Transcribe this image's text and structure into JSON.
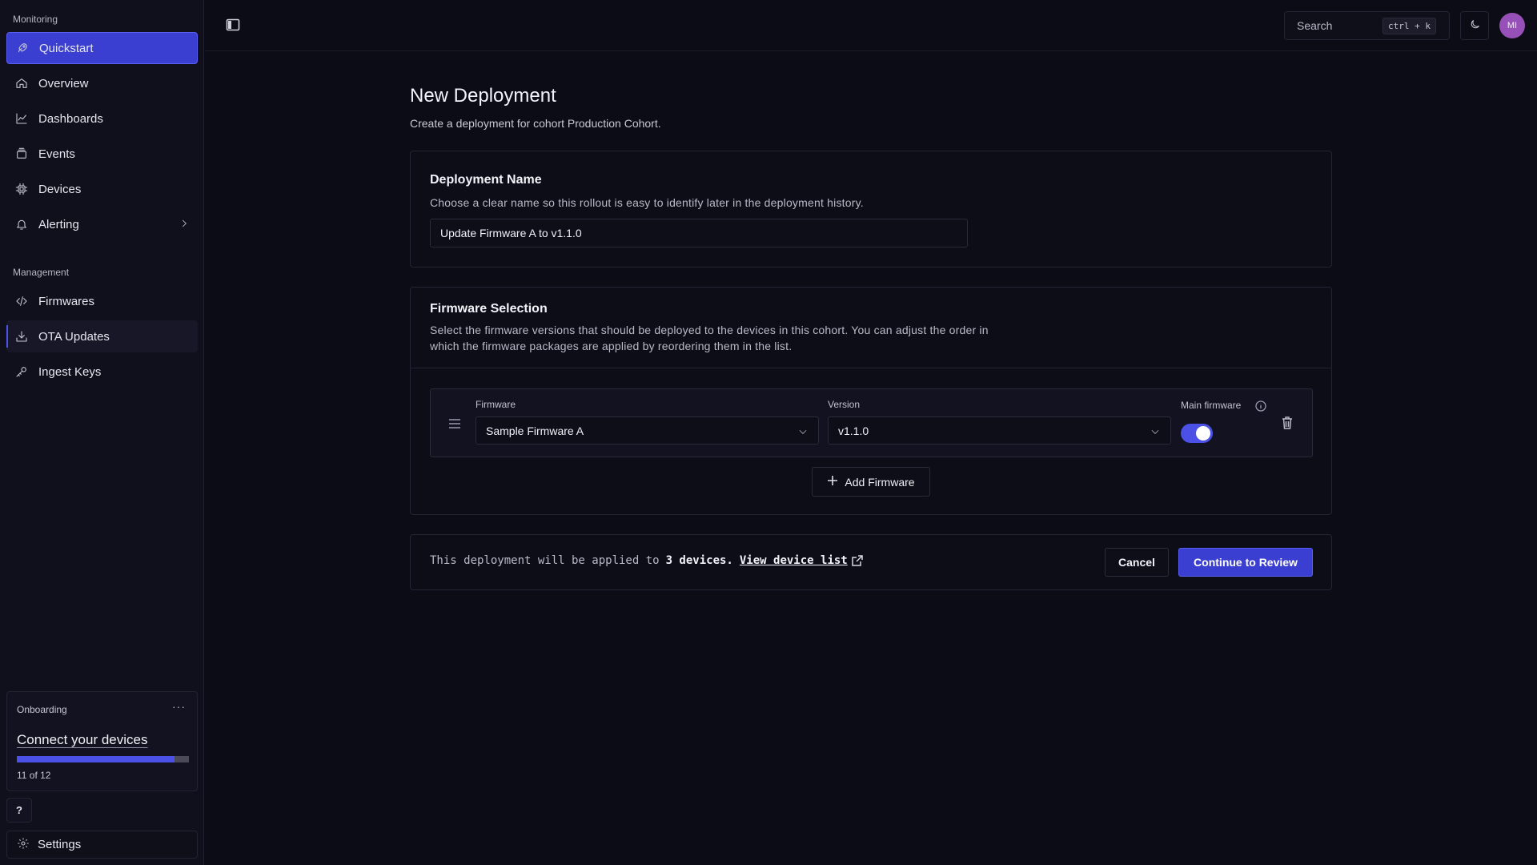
{
  "sidebar": {
    "monitoring_label": "Monitoring",
    "management_label": "Management",
    "items": [
      {
        "label": "Quickstart",
        "icon": "rocket-icon"
      },
      {
        "label": "Overview",
        "icon": "home-icon"
      },
      {
        "label": "Dashboards",
        "icon": "chart-line-icon"
      },
      {
        "label": "Events",
        "icon": "stack-icon"
      },
      {
        "label": "Devices",
        "icon": "chip-icon"
      },
      {
        "label": "Alerting",
        "icon": "bell-icon"
      },
      {
        "label": "Firmwares",
        "icon": "code-icon"
      },
      {
        "label": "OTA Updates",
        "icon": "download-icon"
      },
      {
        "label": "Ingest Keys",
        "icon": "key-icon"
      }
    ],
    "onboarding": {
      "title": "Onboarding",
      "more": "···",
      "heading": "Connect your devices",
      "progress_fraction": 0.917,
      "count_text": "11 of 12"
    },
    "help_label": "?",
    "settings_label": "Settings"
  },
  "topbar": {
    "search_placeholder": "Search",
    "shortcut": "ctrl + k",
    "avatar_initials": "MI"
  },
  "page": {
    "title": "New Deployment",
    "subtitle": "Create a deployment for cohort Production Cohort."
  },
  "deployment_name": {
    "title": "Deployment Name",
    "description": "Choose a clear name so this rollout is easy to identify later in the deployment history.",
    "value": "Update Firmware A to v1.1.0"
  },
  "firmware_selection": {
    "title": "Firmware Selection",
    "description_line1": "Select the firmware versions that should be deployed to the devices in this cohort. You can adjust the order in",
    "description_line2": "which the firmware packages are applied by reordering them in the list.",
    "firmware_label": "Firmware",
    "version_label": "Version",
    "main_label": "Main firmware",
    "firmware_value": "Sample Firmware A",
    "version_value": "v1.1.0",
    "main_enabled": true,
    "add_label": "Add Firmware"
  },
  "footer": {
    "text_prefix": "This deployment will be applied to",
    "device_count": "3 devices.",
    "link_label": "View device list",
    "cancel_label": "Cancel",
    "continue_label": "Continue to Review"
  },
  "colors": {
    "accent": "#3a3fd1",
    "background": "#0c0c16",
    "avatar": "#9850b9"
  }
}
